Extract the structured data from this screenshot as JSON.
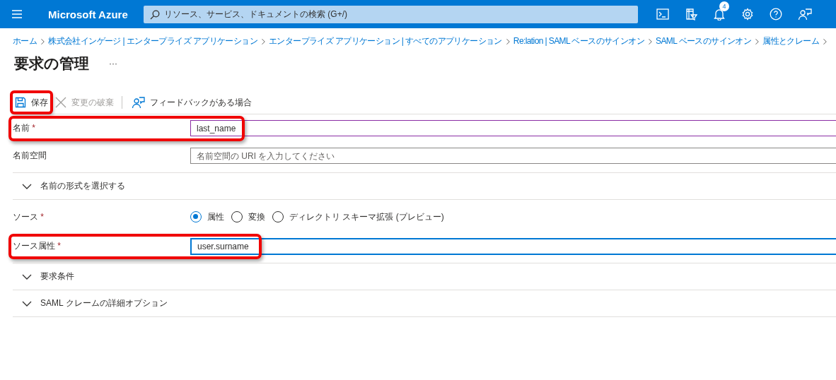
{
  "top_bar": {
    "brand": "Microsoft Azure",
    "search_placeholder": "リソース、サービス、ドキュメントの検索 (G+/)",
    "notification_count": "4"
  },
  "breadcrumb": [
    "ホーム",
    "株式会社インゲージ | エンタープライズ アプリケーション",
    "エンタープライズ アプリケーション | すべてのアプリケーション",
    "Re:lation | SAML ベースのサインオン",
    "SAML ベースのサインオン",
    "属性とクレーム"
  ],
  "page": {
    "title": "要求の管理",
    "more": "···"
  },
  "toolbar": [
    {
      "kind": "save",
      "label": "保存",
      "disabled": false,
      "highlighted": true
    },
    {
      "kind": "discard",
      "label": "変更の破棄",
      "disabled": true,
      "highlighted": false
    },
    {
      "kind": "feedback",
      "label": "フィードバックがある場合",
      "disabled": false,
      "highlighted": false
    }
  ],
  "form": [
    {
      "kind": "input",
      "label": "名前",
      "required_mark": "*",
      "value": "last_name",
      "focused": true,
      "highlighted": true
    },
    {
      "kind": "input",
      "label": "名前空間",
      "placeholder": "名前空間の URI を入力してください",
      "focused": false,
      "highlighted": false
    },
    {
      "kind": "expander",
      "label": "名前の形式を選択する",
      "expanded": false
    },
    {
      "kind": "radio",
      "label": "ソース",
      "required_mark": "*",
      "options": [
        {
          "label": "属性",
          "selected": true
        },
        {
          "label": "変換",
          "selected": false
        },
        {
          "label": "ディレクトリ スキーマ拡張 (プレビュー)",
          "selected": false
        }
      ]
    },
    {
      "kind": "input",
      "label": "ソース属性",
      "required_mark": "*",
      "value": "user.surname",
      "focused": false,
      "active": true,
      "highlighted": true
    },
    {
      "kind": "expander",
      "label": "要求条件",
      "expanded": false
    },
    {
      "kind": "expander",
      "label": "SAML クレームの詳細オプション",
      "expanded": false
    }
  ]
}
